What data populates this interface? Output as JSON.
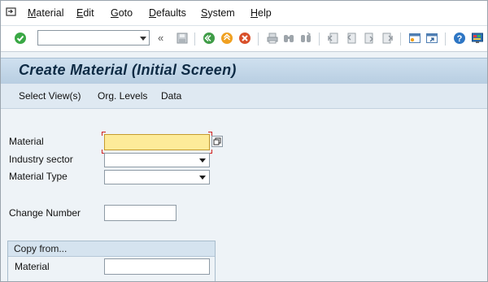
{
  "menu": {
    "items": [
      {
        "mnemonic": "M",
        "rest": "aterial"
      },
      {
        "mnemonic": "E",
        "rest": "dit"
      },
      {
        "mnemonic": "G",
        "rest": "oto"
      },
      {
        "mnemonic": "D",
        "rest": "efaults"
      },
      {
        "mnemonic": "S",
        "rest": "ystem"
      },
      {
        "mnemonic": "H",
        "rest": "elp"
      }
    ]
  },
  "toolbar": {
    "command_field": {
      "value": ""
    },
    "icons": [
      "enter-check-icon",
      "back-icon",
      "exit-icon",
      "cancel-icon",
      "print-icon",
      "find-icon",
      "find-next-icon",
      "first-page-icon",
      "previous-page-icon",
      "next-page-icon",
      "last-page-icon",
      "create-session-icon",
      "shortcut-icon",
      "help-icon",
      "customize-layout-icon"
    ]
  },
  "title": "Create Material (Initial Screen)",
  "app_toolbar": {
    "buttons": [
      "Select View(s)",
      "Org. Levels",
      "Data"
    ]
  },
  "form": {
    "material_label": "Material",
    "material_value": "",
    "industry_label": "Industry sector",
    "industry_value": "",
    "type_label": "Material Type",
    "type_value": "",
    "change_label": "Change Number",
    "change_value": ""
  },
  "copy_from": {
    "title": "Copy from...",
    "material_label": "Material",
    "material_value": ""
  },
  "colors": {
    "required_field": "#fdeb99",
    "title_band": "#c3d7ea",
    "title_text": "#0d2a44"
  }
}
